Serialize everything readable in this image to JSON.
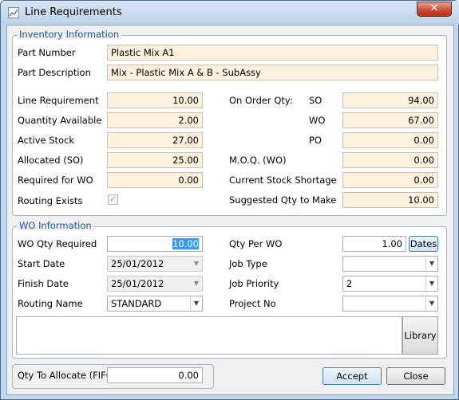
{
  "window": {
    "title": "Line Requirements",
    "close_glyph": "✕"
  },
  "inventory": {
    "group_title": "Inventory Information",
    "part_number_label": "Part Number",
    "part_number": "Plastic Mix A1",
    "part_description_label": "Part Description",
    "part_description": "Mix - Plastic Mix A & B - SubAssy",
    "line_requirement_label": "Line Requirement",
    "line_requirement": "10.00",
    "quantity_available_label": "Quantity Available",
    "quantity_available": "2.00",
    "active_stock_label": "Active Stock",
    "active_stock": "27.00",
    "allocated_label": "Allocated (SO)",
    "allocated": "25.00",
    "required_wo_label": "Required for WO",
    "required_wo": "0.00",
    "routing_exists_label": "Routing Exists",
    "routing_exists_checked": true,
    "check_glyph": "✓",
    "on_order_label": "On Order Qty:",
    "so_label": "SO",
    "so": "94.00",
    "wo_label": "WO",
    "wo": "67.00",
    "po_label": "PO",
    "po": "0.00",
    "moq_label": "M.O.Q. (WO)",
    "moq": "0.00",
    "shortage_label": "Current Stock Shortage",
    "shortage": "0.00",
    "suggested_label": "Suggested Qty to Make",
    "suggested": "10.00"
  },
  "wo": {
    "group_title": "WO Information",
    "qty_required_label": "WO Qty Required",
    "qty_required": "10.00",
    "start_date_label": "Start Date",
    "start_date": "25/01/2012",
    "finish_date_label": "Finish Date",
    "finish_date": "25/01/2012",
    "routing_name_label": "Routing Name",
    "routing_name": "STANDARD",
    "qty_per_wo_label": "Qty Per WO",
    "qty_per_wo": "1.00",
    "dates_button": "Dates",
    "job_type_label": "Job Type",
    "job_type": "",
    "job_priority_label": "Job Priority",
    "job_priority": "2",
    "project_no_label": "Project No",
    "project_no": "",
    "notes": "",
    "library_button": "Library",
    "arrow_glyph": "▼"
  },
  "footer": {
    "allocate_label": "Qty To Allocate (FIFO)",
    "allocate": "0.00",
    "accept_button": "Accept",
    "close_button": "Close"
  }
}
